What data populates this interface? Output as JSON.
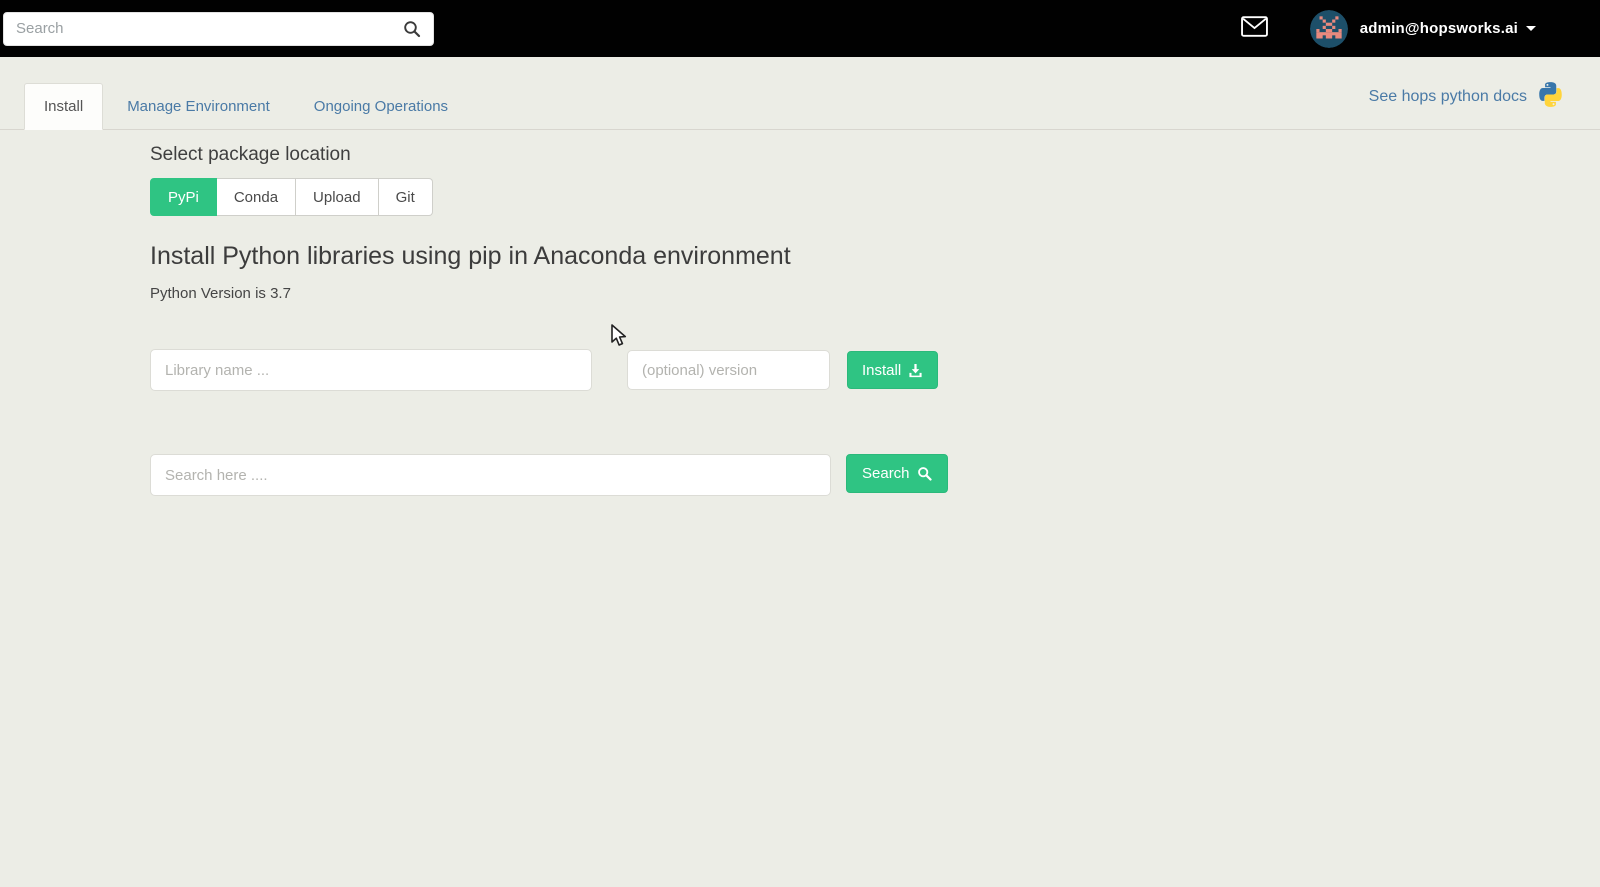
{
  "topbar": {
    "search_placeholder": "Search",
    "user_email": "admin@hopsworks.ai"
  },
  "tabs": [
    {
      "label": "Install",
      "active": true
    },
    {
      "label": "Manage Environment",
      "active": false
    },
    {
      "label": "Ongoing Operations",
      "active": false
    }
  ],
  "docs": {
    "label": "See hops python docs"
  },
  "install": {
    "location_heading": "Select package location",
    "locations": [
      "PyPi",
      "Conda",
      "Upload",
      "Git"
    ],
    "active_location": "PyPi",
    "title": "Install Python libraries using pip in Anaconda environment",
    "python_version": "Python Version is 3.7",
    "library_placeholder": "Library name ...",
    "version_placeholder": "(optional) version",
    "install_button_label": "Install",
    "search_placeholder": "Search here ....",
    "search_button_label": "Search"
  },
  "colors": {
    "topbar_bg": "#010101",
    "page_bg": "#ecede6",
    "accent_green": "#2fc483",
    "link_blue": "#4a7aa6",
    "avatar_navy": "#1d4f69",
    "avatar_salmon": "#e8897e",
    "python_blue": "#3776ab",
    "python_yellow": "#ffd43b"
  },
  "icons": {
    "search-icon": "magnifier",
    "messages-icon": "envelope-outline",
    "chevron-down-icon": "triangle-down",
    "python-logo-icon": "python-two-snakes",
    "install-download-icon": "download-tray",
    "avatar": "pixel-art-identicon",
    "mouse-cursor": "arrow-pointer"
  }
}
